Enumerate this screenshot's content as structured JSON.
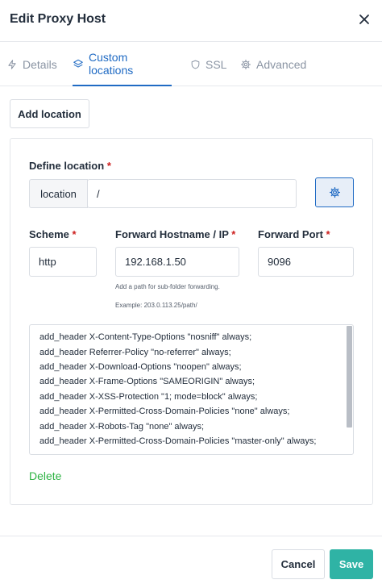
{
  "dialog": {
    "title": "Edit Proxy Host"
  },
  "tabs": [
    {
      "label": "Details",
      "icon": "bolt-icon",
      "active": false
    },
    {
      "label": "Custom locations",
      "icon": "layers-icon",
      "active": true
    },
    {
      "label": "SSL",
      "icon": "shield-icon",
      "active": false
    },
    {
      "label": "Advanced",
      "icon": "gear-icon",
      "active": false
    }
  ],
  "add_location_label": "Add location",
  "location": {
    "define_label": "Define location",
    "required_mark": "*",
    "addon": "location",
    "path_value": "/",
    "scheme_label": "Scheme",
    "scheme_value": "http",
    "host_label": "Forward Hostname / IP",
    "host_value": "192.168.1.50",
    "host_hint": "Add a path for sub-folder forwarding.",
    "host_example": "Example: 203.0.113.25/path/",
    "port_label": "Forward Port",
    "port_value": "9096",
    "config_lines": [
      "add_header X-Content-Type-Options \"nosniff\" always;",
      "add_header Referrer-Policy \"no-referrer\" always;",
      "add_header X-Download-Options \"noopen\" always;",
      "add_header X-Frame-Options \"SAMEORIGIN\" always;",
      "add_header X-XSS-Protection \"1; mode=block\" always;",
      "add_header X-Permitted-Cross-Domain-Policies \"none\" always;",
      "add_header X-Robots-Tag \"none\" always;",
      "add_header X-Permitted-Cross-Domain-Policies \"master-only\" always;"
    ],
    "delete_label": "Delete"
  },
  "footer": {
    "cancel_label": "Cancel",
    "save_label": "Save"
  },
  "colors": {
    "accent": "#206bc4",
    "save": "#2fb3a5",
    "delete": "#2fb344",
    "required": "#cd201f"
  }
}
